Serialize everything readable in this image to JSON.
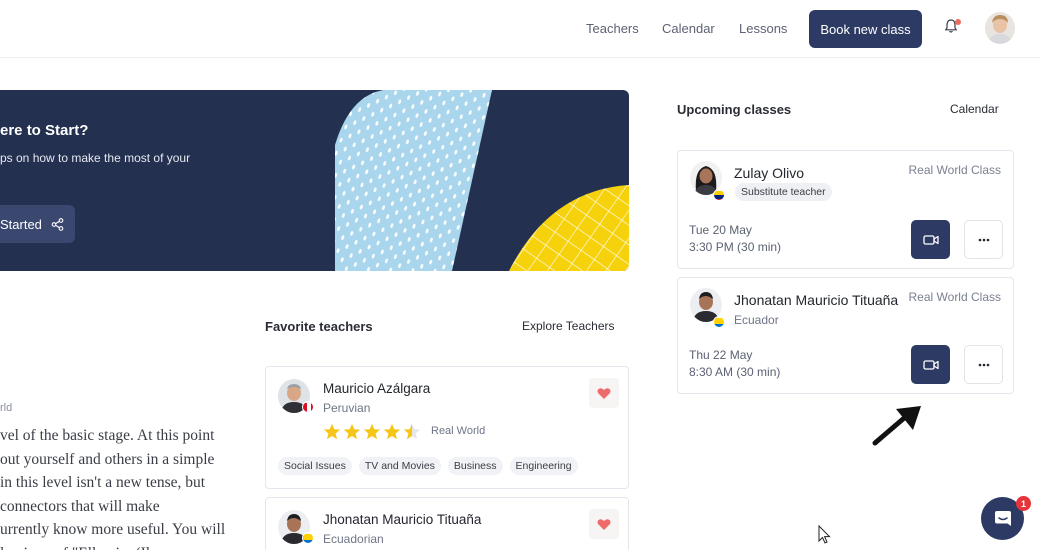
{
  "nav": {
    "links": [
      "Teachers",
      "Calendar",
      "Lessons"
    ],
    "book_label": "Book new class"
  },
  "hero": {
    "title": "ere to Start?",
    "subtitle": "ps on how to make the most of your",
    "button_label": "Started"
  },
  "favorites": {
    "title": "Favorite teachers",
    "link": "Explore Teachers",
    "teachers": [
      {
        "name": "Mauricio Azálgara",
        "nationality": "Peruvian",
        "rating": 4.5,
        "rating_label": "Real World",
        "tags": [
          "Social Issues",
          "TV and Movies",
          "Business",
          "Engineering"
        ],
        "flag": "peru-flag-icon"
      },
      {
        "name": "Jhonatan Mauricio Tituaña",
        "nationality": "Ecuadorian",
        "flag": "ecuador-flag-icon"
      }
    ]
  },
  "left_text": {
    "label": "rld",
    "paragraph_lines": [
      "vel of the basic stage. At this point",
      "out yourself and others in a simple",
      "in this level isn't a new tense, but",
      "connectors that will make",
      "urrently know more useful. You will",
      "l ... i ... ... f \"Ell ... i... (Il ... ... "
    ]
  },
  "upcoming": {
    "title": "Upcoming classes",
    "link": "Calendar",
    "classes": [
      {
        "name": "Zulay Olivo",
        "badge": "Substitute teacher",
        "type": "Real World Class",
        "date": "Tue 20 May",
        "time": "3:30 PM (30 min)"
      },
      {
        "name": "Jhonatan Mauricio Tituaña",
        "country": "Ecuador",
        "type": "Real World Class",
        "date": "Thu 22 May",
        "time": "8:30 AM (30 min)"
      }
    ]
  },
  "chat": {
    "badge": "1"
  },
  "colors": {
    "primary": "#2d3b64",
    "accent_yellow": "#f6d20c",
    "accent_blue": "#a9d6ec",
    "heart": "#ef6a6a"
  }
}
